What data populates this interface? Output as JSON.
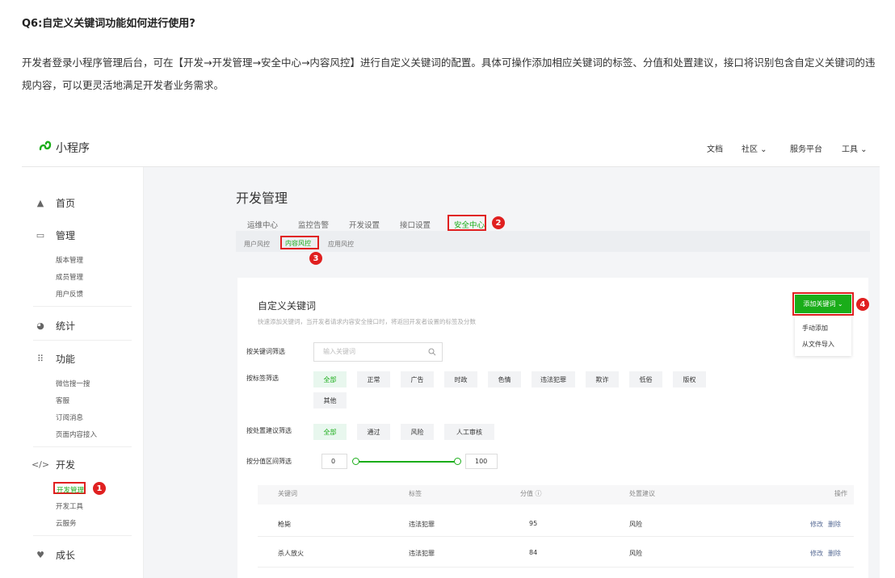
{
  "question": {
    "title": "Q6:自定义关键词功能如何进行使用?",
    "body": "开发者登录小程序管理后台，可在【开发→开发管理→安全中心→内容风控】进行自定义关键词的配置。具体可操作添加相应关键词的标签、分值和处置建议，接口将识别包含自定义关键词的违规内容，可以更灵活地满足开发者业务需求。"
  },
  "brand": {
    "name": "小程序",
    "color": "#1aad19"
  },
  "topnav": {
    "docs": "文档",
    "community": "社区",
    "service": "服务平台",
    "tools": "工具"
  },
  "sidebar": {
    "home": "首页",
    "manage": "管理",
    "manage_items": [
      "版本管理",
      "成员管理",
      "用户反馈"
    ],
    "stats": "统计",
    "features": "功能",
    "feature_items": [
      "微信搜一搜",
      "客服",
      "订阅消息",
      "页面内容接入"
    ],
    "dev": "开发",
    "dev_items": [
      "开发管理",
      "开发工具",
      "云服务"
    ],
    "growth": "成长"
  },
  "main": {
    "title": "开发管理",
    "tabs": [
      "运维中心",
      "监控告警",
      "开发设置",
      "接口设置",
      "安全中心"
    ],
    "subtabs": [
      "用户风控",
      "内容风控",
      "应用风控"
    ]
  },
  "card": {
    "title": "自定义关键词",
    "desc": "快速添加关键词，当开发者请求内容安全接口时，将返回开发者设置的标签及分数",
    "add_button": "添加关键词",
    "dropdown": [
      "手动添加",
      "从文件导入"
    ],
    "filter_keyword_label": "按关键词筛选",
    "search_placeholder": "输入关键词",
    "filter_tag_label": "按标签筛选",
    "tags": [
      "全部",
      "正常",
      "广告",
      "时政",
      "色情",
      "违法犯罪",
      "欺诈",
      "低俗",
      "版权",
      "其他"
    ],
    "filter_action_label": "按处置建议筛选",
    "actions": [
      "全部",
      "通过",
      "风险",
      "人工审核"
    ],
    "filter_score_label": "按分值区间筛选",
    "score_min": "0",
    "score_max": "100",
    "columns": [
      "关键词",
      "标签",
      "分值 ⓘ",
      "处置建议",
      "操作"
    ],
    "rows": [
      {
        "keyword": "枪毙",
        "tag": "违法犯罪",
        "score": "95",
        "action": "风险",
        "edit": "修改",
        "delete": "删除"
      },
      {
        "keyword": "杀人放火",
        "tag": "违法犯罪",
        "score": "84",
        "action": "风险",
        "edit": "修改",
        "delete": "删除"
      }
    ]
  },
  "annotations": [
    "1",
    "2",
    "3",
    "4"
  ],
  "colors": {
    "annotation": "#e02020",
    "accent": "#1aad19",
    "link": "#576b95"
  }
}
